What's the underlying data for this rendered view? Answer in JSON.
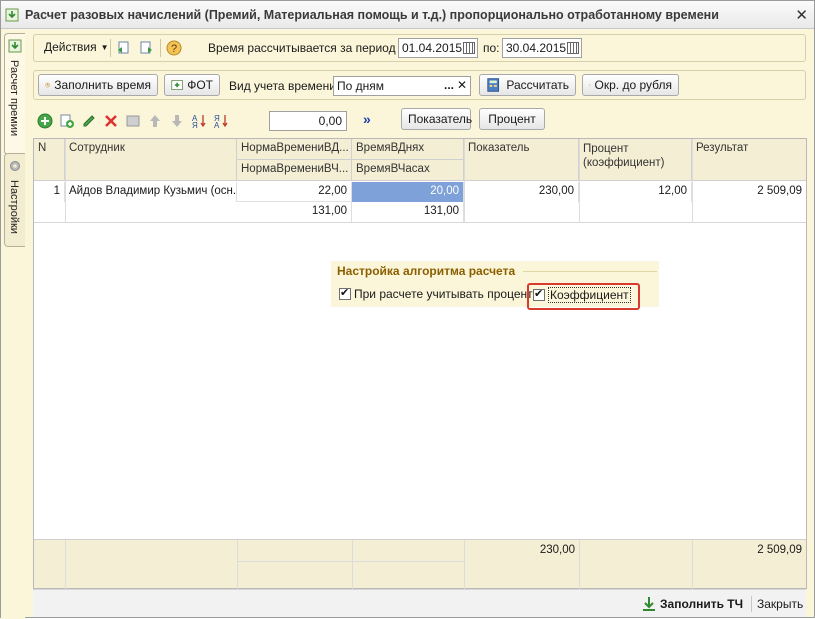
{
  "window": {
    "title": "Расчет разовых начислений (Премий, Материальная помощь и т.д.) пропорционально отработанному времени",
    "close_icon": "close-icon"
  },
  "side_tabs": [
    {
      "label": "Расчет премии",
      "icon": "arrow-down-green-icon"
    },
    {
      "label": "Настройки",
      "icon": "gear-icon"
    }
  ],
  "toolbar1": {
    "actions_label": "Действия",
    "period_label": "Время рассчитывается за период с:",
    "date_from": "01.04.2015",
    "to_label": "по:",
    "date_to": "30.04.2015"
  },
  "toolbar2": {
    "fill_time_label": "Заполнить время",
    "fot_label": "ФОТ",
    "time_type_label": "Вид учета времени:",
    "time_type_value": "По дням",
    "calculate_label": "Рассчитать",
    "round_label": "Окр. до рубля"
  },
  "toolbar3": {
    "amount_value": "0,00",
    "indicator_label": "Показатель",
    "percent_label": "Процент"
  },
  "table": {
    "headers": {
      "n": "N",
      "employee": "Сотрудник",
      "norm_days": "НормаВремениВД...",
      "norm_hours": "НормаВремениВЧ...",
      "time_days": "ВремяВДнях",
      "time_hours": "ВремяВЧасах",
      "indicator": "Показатель",
      "percent": "Процент (коэффициент)",
      "result": "Результат"
    },
    "rows": [
      {
        "n": "1",
        "employee": "Айдов Владимир Кузьмич (осн.)",
        "norm_days": "22,00",
        "norm_hours": "131,00",
        "time_days": "20,00",
        "time_hours": "131,00",
        "indicator": "230,00",
        "percent": "12,00",
        "result": "2 509,09"
      }
    ],
    "totals": {
      "indicator": "230,00",
      "result": "2 509,09"
    }
  },
  "settings_group": {
    "title": "Настройка алгоритма расчета",
    "consider_percent_label": "При расчете учитывать проценты",
    "coefficient_label": "Коэффициент"
  },
  "bottom": {
    "fill_tc_label": "Заполнить ТЧ",
    "close_label": "Закрыть"
  }
}
